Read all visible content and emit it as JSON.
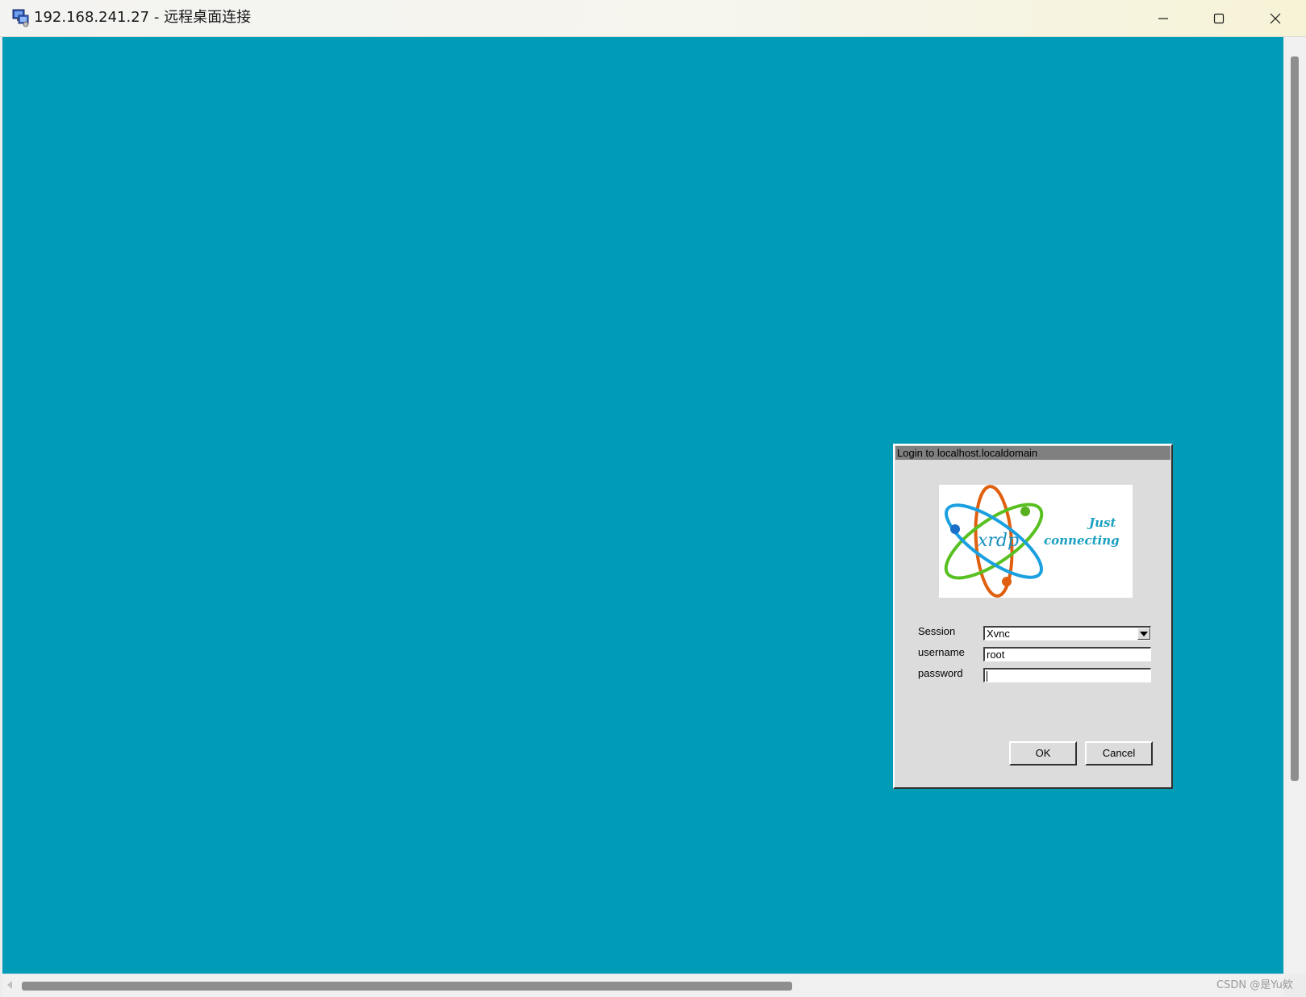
{
  "window": {
    "title": "192.168.241.27 - 远程桌面连接",
    "icon": "remote-desktop-icon",
    "controls": [
      "minimize-icon",
      "maximize-icon",
      "close-icon"
    ]
  },
  "login_dialog": {
    "title": "Login to localhost.localdomain",
    "logo": {
      "brand": "xrdp",
      "tagline_line1": "Just",
      "tagline_line2": "connecting"
    },
    "fields": {
      "session_label": "Session",
      "session_value": "Xvnc",
      "username_label": "username",
      "username_value": "root",
      "password_label": "password",
      "password_value": ""
    },
    "buttons": {
      "ok": "OK",
      "cancel": "Cancel"
    }
  },
  "watermark": "CSDN @是Yu欸",
  "colors": {
    "desktop_background": "#009cb7",
    "dialog_background": "#dcdcdc",
    "dialog_titlebar": "#808080"
  }
}
